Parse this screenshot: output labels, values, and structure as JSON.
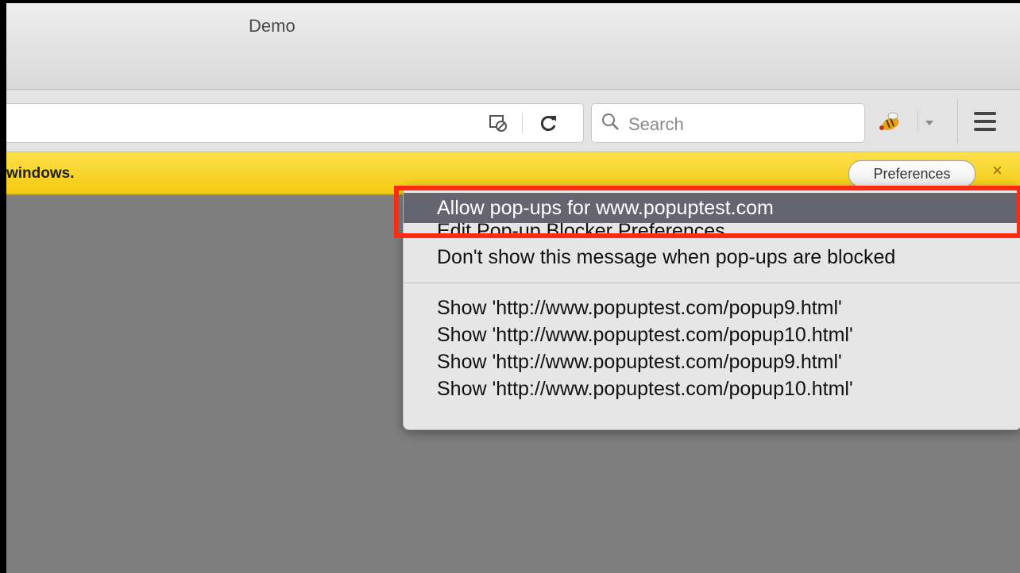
{
  "window": {
    "title": "Demo"
  },
  "toolbar": {
    "search_placeholder": "Search"
  },
  "notification": {
    "message": "windows.",
    "preferences_label": "Preferences",
    "close_label": "×"
  },
  "popup_menu": {
    "items": [
      "Allow pop-ups for www.popuptest.com",
      "Edit Pop-up Blocker Preferences…",
      "Don't show this message when pop-ups are blocked"
    ],
    "popups": [
      "Show 'http://www.popuptest.com/popup9.html'",
      "Show 'http://www.popuptest.com/popup10.html'",
      "Show 'http://www.popuptest.com/popup9.html'",
      "Show 'http://www.popuptest.com/popup10.html'"
    ]
  },
  "colors": {
    "notification_bar": "#f5cb11",
    "highlight": "#656570",
    "annotation_box": "#ff2a12"
  }
}
